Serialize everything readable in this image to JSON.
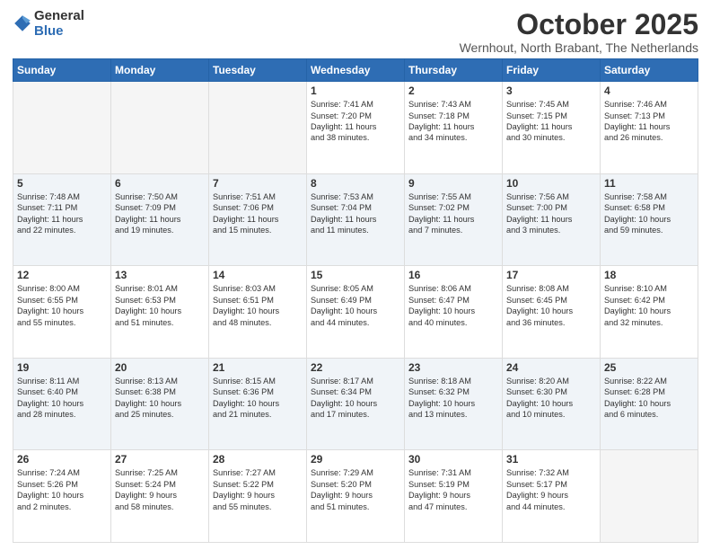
{
  "logo": {
    "general": "General",
    "blue": "Blue"
  },
  "header": {
    "month": "October 2025",
    "location": "Wernhout, North Brabant, The Netherlands"
  },
  "days": [
    "Sunday",
    "Monday",
    "Tuesday",
    "Wednesday",
    "Thursday",
    "Friday",
    "Saturday"
  ],
  "weeks": [
    [
      {
        "num": "",
        "lines": []
      },
      {
        "num": "",
        "lines": []
      },
      {
        "num": "",
        "lines": []
      },
      {
        "num": "1",
        "lines": [
          "Sunrise: 7:41 AM",
          "Sunset: 7:20 PM",
          "Daylight: 11 hours",
          "and 38 minutes."
        ]
      },
      {
        "num": "2",
        "lines": [
          "Sunrise: 7:43 AM",
          "Sunset: 7:18 PM",
          "Daylight: 11 hours",
          "and 34 minutes."
        ]
      },
      {
        "num": "3",
        "lines": [
          "Sunrise: 7:45 AM",
          "Sunset: 7:15 PM",
          "Daylight: 11 hours",
          "and 30 minutes."
        ]
      },
      {
        "num": "4",
        "lines": [
          "Sunrise: 7:46 AM",
          "Sunset: 7:13 PM",
          "Daylight: 11 hours",
          "and 26 minutes."
        ]
      }
    ],
    [
      {
        "num": "5",
        "lines": [
          "Sunrise: 7:48 AM",
          "Sunset: 7:11 PM",
          "Daylight: 11 hours",
          "and 22 minutes."
        ]
      },
      {
        "num": "6",
        "lines": [
          "Sunrise: 7:50 AM",
          "Sunset: 7:09 PM",
          "Daylight: 11 hours",
          "and 19 minutes."
        ]
      },
      {
        "num": "7",
        "lines": [
          "Sunrise: 7:51 AM",
          "Sunset: 7:06 PM",
          "Daylight: 11 hours",
          "and 15 minutes."
        ]
      },
      {
        "num": "8",
        "lines": [
          "Sunrise: 7:53 AM",
          "Sunset: 7:04 PM",
          "Daylight: 11 hours",
          "and 11 minutes."
        ]
      },
      {
        "num": "9",
        "lines": [
          "Sunrise: 7:55 AM",
          "Sunset: 7:02 PM",
          "Daylight: 11 hours",
          "and 7 minutes."
        ]
      },
      {
        "num": "10",
        "lines": [
          "Sunrise: 7:56 AM",
          "Sunset: 7:00 PM",
          "Daylight: 11 hours",
          "and 3 minutes."
        ]
      },
      {
        "num": "11",
        "lines": [
          "Sunrise: 7:58 AM",
          "Sunset: 6:58 PM",
          "Daylight: 10 hours",
          "and 59 minutes."
        ]
      }
    ],
    [
      {
        "num": "12",
        "lines": [
          "Sunrise: 8:00 AM",
          "Sunset: 6:55 PM",
          "Daylight: 10 hours",
          "and 55 minutes."
        ]
      },
      {
        "num": "13",
        "lines": [
          "Sunrise: 8:01 AM",
          "Sunset: 6:53 PM",
          "Daylight: 10 hours",
          "and 51 minutes."
        ]
      },
      {
        "num": "14",
        "lines": [
          "Sunrise: 8:03 AM",
          "Sunset: 6:51 PM",
          "Daylight: 10 hours",
          "and 48 minutes."
        ]
      },
      {
        "num": "15",
        "lines": [
          "Sunrise: 8:05 AM",
          "Sunset: 6:49 PM",
          "Daylight: 10 hours",
          "and 44 minutes."
        ]
      },
      {
        "num": "16",
        "lines": [
          "Sunrise: 8:06 AM",
          "Sunset: 6:47 PM",
          "Daylight: 10 hours",
          "and 40 minutes."
        ]
      },
      {
        "num": "17",
        "lines": [
          "Sunrise: 8:08 AM",
          "Sunset: 6:45 PM",
          "Daylight: 10 hours",
          "and 36 minutes."
        ]
      },
      {
        "num": "18",
        "lines": [
          "Sunrise: 8:10 AM",
          "Sunset: 6:42 PM",
          "Daylight: 10 hours",
          "and 32 minutes."
        ]
      }
    ],
    [
      {
        "num": "19",
        "lines": [
          "Sunrise: 8:11 AM",
          "Sunset: 6:40 PM",
          "Daylight: 10 hours",
          "and 28 minutes."
        ]
      },
      {
        "num": "20",
        "lines": [
          "Sunrise: 8:13 AM",
          "Sunset: 6:38 PM",
          "Daylight: 10 hours",
          "and 25 minutes."
        ]
      },
      {
        "num": "21",
        "lines": [
          "Sunrise: 8:15 AM",
          "Sunset: 6:36 PM",
          "Daylight: 10 hours",
          "and 21 minutes."
        ]
      },
      {
        "num": "22",
        "lines": [
          "Sunrise: 8:17 AM",
          "Sunset: 6:34 PM",
          "Daylight: 10 hours",
          "and 17 minutes."
        ]
      },
      {
        "num": "23",
        "lines": [
          "Sunrise: 8:18 AM",
          "Sunset: 6:32 PM",
          "Daylight: 10 hours",
          "and 13 minutes."
        ]
      },
      {
        "num": "24",
        "lines": [
          "Sunrise: 8:20 AM",
          "Sunset: 6:30 PM",
          "Daylight: 10 hours",
          "and 10 minutes."
        ]
      },
      {
        "num": "25",
        "lines": [
          "Sunrise: 8:22 AM",
          "Sunset: 6:28 PM",
          "Daylight: 10 hours",
          "and 6 minutes."
        ]
      }
    ],
    [
      {
        "num": "26",
        "lines": [
          "Sunrise: 7:24 AM",
          "Sunset: 5:26 PM",
          "Daylight: 10 hours",
          "and 2 minutes."
        ]
      },
      {
        "num": "27",
        "lines": [
          "Sunrise: 7:25 AM",
          "Sunset: 5:24 PM",
          "Daylight: 9 hours",
          "and 58 minutes."
        ]
      },
      {
        "num": "28",
        "lines": [
          "Sunrise: 7:27 AM",
          "Sunset: 5:22 PM",
          "Daylight: 9 hours",
          "and 55 minutes."
        ]
      },
      {
        "num": "29",
        "lines": [
          "Sunrise: 7:29 AM",
          "Sunset: 5:20 PM",
          "Daylight: 9 hours",
          "and 51 minutes."
        ]
      },
      {
        "num": "30",
        "lines": [
          "Sunrise: 7:31 AM",
          "Sunset: 5:19 PM",
          "Daylight: 9 hours",
          "and 47 minutes."
        ]
      },
      {
        "num": "31",
        "lines": [
          "Sunrise: 7:32 AM",
          "Sunset: 5:17 PM",
          "Daylight: 9 hours",
          "and 44 minutes."
        ]
      },
      {
        "num": "",
        "lines": []
      }
    ]
  ]
}
